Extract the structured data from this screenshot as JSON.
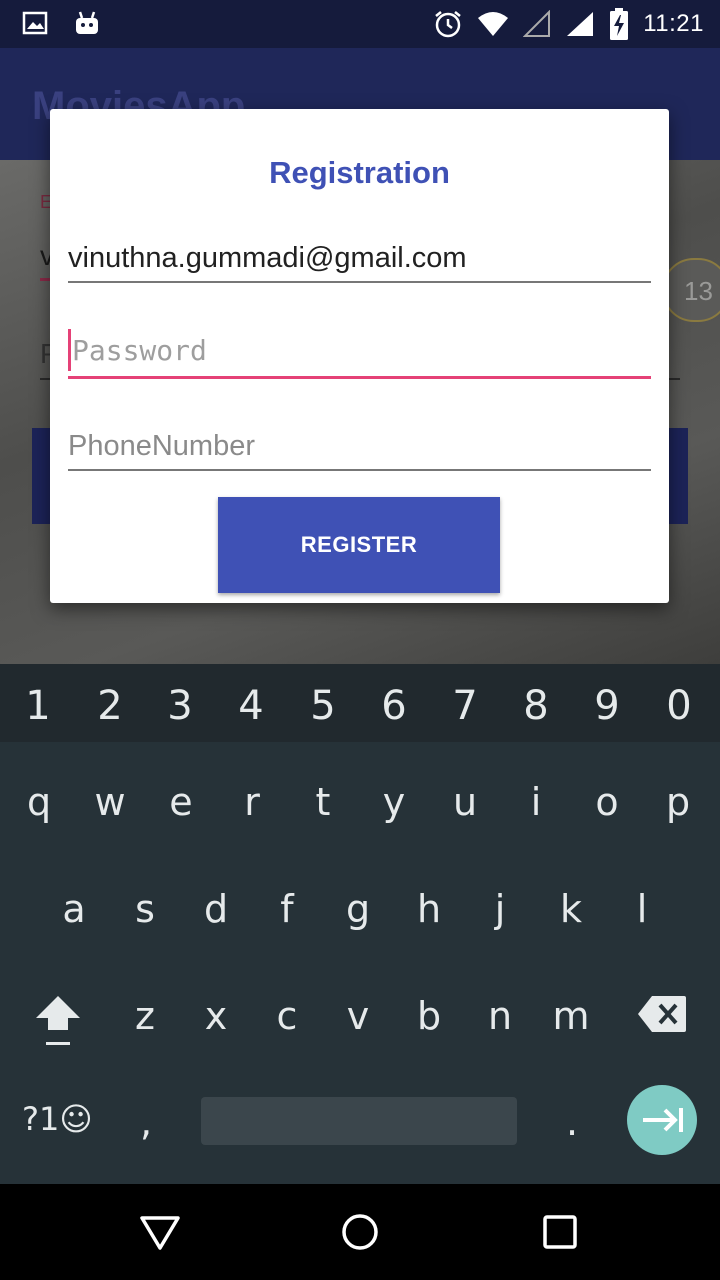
{
  "status_bar": {
    "time": "11:21",
    "icons": [
      "image-icon",
      "android-icon",
      "alarm-icon",
      "wifi-icon",
      "signal-empty-icon",
      "signal-full-icon",
      "battery-charging-icon"
    ]
  },
  "background_app": {
    "title": "MoviesApp",
    "email_label": "E",
    "email_value_fragment": "v",
    "password_fragment": "P",
    "badge_count": "13"
  },
  "dialog": {
    "title": "Registration",
    "email_value": "vinuthna.gummadi@gmail.com",
    "password_placeholder": "Password",
    "phone_placeholder": "PhoneNumber",
    "register_label": "REGISTER"
  },
  "keyboard": {
    "number_row": [
      "1",
      "2",
      "3",
      "4",
      "5",
      "6",
      "7",
      "8",
      "9",
      "0"
    ],
    "row1": [
      "q",
      "w",
      "e",
      "r",
      "t",
      "y",
      "u",
      "i",
      "o",
      "p"
    ],
    "row2": [
      "a",
      "s",
      "d",
      "f",
      "g",
      "h",
      "j",
      "k",
      "l"
    ],
    "row3": [
      "z",
      "x",
      "c",
      "v",
      "b",
      "n",
      "m"
    ],
    "symbols_label": "?1☺",
    "comma": ",",
    "period": "."
  },
  "colors": {
    "accent": "#3f51b5",
    "focus": "#e54177",
    "keyboard_bg": "#263238",
    "enter_key": "#7fcbc4"
  }
}
